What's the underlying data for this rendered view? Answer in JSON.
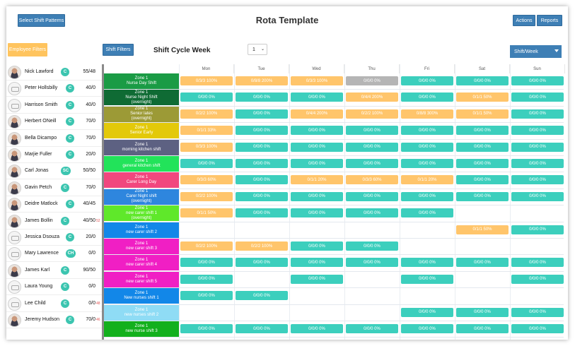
{
  "header": {
    "title": "Rota Template",
    "select_patterns_label": "Select Shift Patterns",
    "actions_label": "Actions",
    "reports_label": "Reports"
  },
  "toolbar": {
    "employee_filters_label": "Employee Filters",
    "shift_filters_label": "Shift Filters",
    "cycle_week_label": "Shift Cycle Week",
    "cycle_week_value": "1",
    "view_mode": "Shift/Week"
  },
  "days": [
    "Mon",
    "Tue",
    "Wed",
    "Thu",
    "Fri",
    "Sat",
    "Sun"
  ],
  "employees": [
    {
      "name": "Nick Lawford",
      "badge": "C",
      "ratio": "55/48",
      "extra": "",
      "avatar": "photo"
    },
    {
      "name": "Peter Hollsbilly",
      "badge": "C",
      "ratio": "40/0",
      "extra": "",
      "avatar": "logo"
    },
    {
      "name": "Harrison Smith",
      "badge": "C",
      "ratio": "40/0",
      "extra": "",
      "avatar": "logo"
    },
    {
      "name": "Herbert ONeill",
      "badge": "C",
      "ratio": "70/0",
      "extra": "",
      "avatar": "photo"
    },
    {
      "name": "Bella Dicampo",
      "badge": "C",
      "ratio": "70/0",
      "extra": "",
      "avatar": "photo"
    },
    {
      "name": "Marjie Fuller",
      "badge": "C",
      "ratio": "20/0",
      "extra": "",
      "avatar": "photo"
    },
    {
      "name": "Carl Jonas",
      "badge": "SC",
      "ratio": "50/50",
      "extra": "",
      "avatar": "photo"
    },
    {
      "name": "Gavin Petch",
      "badge": "C",
      "ratio": "70/0",
      "extra": "",
      "avatar": "photo"
    },
    {
      "name": "Deidre Matlock",
      "badge": "C",
      "ratio": "40/45",
      "extra": "",
      "avatar": "photo"
    },
    {
      "name": "James Bollin",
      "badge": "C",
      "ratio": "40/50",
      "extra": "52",
      "avatar": "photo"
    },
    {
      "name": "Jessica Dsouza",
      "badge": "C",
      "ratio": "20/0",
      "extra": "",
      "avatar": "logo"
    },
    {
      "name": "Mary Lawrence",
      "badge": "CH",
      "ratio": "0/0",
      "extra": "",
      "avatar": "logo"
    },
    {
      "name": "James Karl",
      "badge": "C",
      "ratio": "90/50",
      "extra": "",
      "avatar": "photo"
    },
    {
      "name": "Laura Young",
      "badge": "C",
      "ratio": "0/0",
      "extra": "",
      "avatar": "logo"
    },
    {
      "name": "Lee Child",
      "badge": "C",
      "ratio": "0/0",
      "extra": "48",
      "avatar": "logo"
    },
    {
      "name": "Jeremy Hudson",
      "badge": "C",
      "ratio": "70/0",
      "extra": "46",
      "avatar": "photo"
    }
  ],
  "shifts": [
    {
      "zone": "Zone 1",
      "name": "Nurse Day Shift",
      "sub": "",
      "color": "#1a9b45",
      "cells": [
        {
          "t": "0/3/3 100%",
          "c": "o"
        },
        {
          "t": "0/8/8 200%",
          "c": "o"
        },
        {
          "t": "0/3/3 100%",
          "c": "o"
        },
        {
          "t": "0/0/0 0%",
          "c": "g"
        },
        {
          "t": "0/0/0 0%",
          "c": "t"
        },
        {
          "t": "0/0/0 0%",
          "c": "t"
        },
        {
          "t": "0/0/0 0%",
          "c": "t"
        }
      ]
    },
    {
      "zone": "Zone 1",
      "name": "Nurse Night Shift",
      "sub": "(overnight)",
      "color": "#0f6b34",
      "cells": [
        {
          "t": "0/0/0 0%",
          "c": "t"
        },
        {
          "t": "0/0/0 0%",
          "c": "t"
        },
        {
          "t": "0/0/0 0%",
          "c": "t"
        },
        {
          "t": "0/4/4 200%",
          "c": "o"
        },
        {
          "t": "0/0/0 0%",
          "c": "t"
        },
        {
          "t": "0/1/1 50%",
          "c": "o"
        },
        {
          "t": "0/0/0 0%",
          "c": "t"
        }
      ]
    },
    {
      "zone": "Zone 1",
      "name": "Senior lates",
      "sub": "(overnight)",
      "color": "#9c9a36",
      "cells": [
        {
          "t": "0/2/2 100%",
          "c": "o"
        },
        {
          "t": "0/0/0 0%",
          "c": "t"
        },
        {
          "t": "0/4/4 200%",
          "c": "o"
        },
        {
          "t": "0/2/2 100%",
          "c": "o"
        },
        {
          "t": "0/8/8 300%",
          "c": "o"
        },
        {
          "t": "0/1/1 50%",
          "c": "o"
        },
        {
          "t": "0/0/0 0%",
          "c": "t"
        }
      ]
    },
    {
      "zone": "Zone 1",
      "name": "Senior Early",
      "sub": "",
      "color": "#e3c90a",
      "cells": [
        {
          "t": "0/1/1 33%",
          "c": "o"
        },
        {
          "t": "0/0/0 0%",
          "c": "t"
        },
        {
          "t": "0/0/0 0%",
          "c": "t"
        },
        {
          "t": "0/0/0 0%",
          "c": "t"
        },
        {
          "t": "0/0/0 0%",
          "c": "t"
        },
        {
          "t": "0/0/0 0%",
          "c": "t"
        },
        {
          "t": "0/0/0 0%",
          "c": "t"
        }
      ]
    },
    {
      "zone": "Zone 1",
      "name": "morning kitchen shift",
      "sub": "",
      "color": "#5d6182",
      "cells": [
        {
          "t": "0/3/3 100%",
          "c": "o"
        },
        {
          "t": "0/0/0 0%",
          "c": "t"
        },
        {
          "t": "0/0/0 0%",
          "c": "t"
        },
        {
          "t": "0/0/0 0%",
          "c": "t"
        },
        {
          "t": "0/0/0 0%",
          "c": "t"
        },
        {
          "t": "0/0/0 0%",
          "c": "t"
        },
        {
          "t": "0/0/0 0%",
          "c": "t"
        }
      ]
    },
    {
      "zone": "Zone 1",
      "name": "general kitchen shift",
      "sub": "",
      "color": "#22e35a",
      "cells": [
        {
          "t": "0/0/0 0%",
          "c": "t"
        },
        {
          "t": "0/0/0 0%",
          "c": "t"
        },
        {
          "t": "0/0/0 0%",
          "c": "t"
        },
        {
          "t": "0/0/0 0%",
          "c": "t"
        },
        {
          "t": "0/0/0 0%",
          "c": "t"
        },
        {
          "t": "0/0/0 0%",
          "c": "t"
        },
        {
          "t": "0/0/0 0%",
          "c": "t"
        }
      ]
    },
    {
      "zone": "Zone 1",
      "name": "Carer Long Day",
      "sub": "",
      "color": "#f1477e",
      "cells": [
        {
          "t": "0/3/3 60%",
          "c": "o"
        },
        {
          "t": "0/0/0 0%",
          "c": "t"
        },
        {
          "t": "0/1/1 20%",
          "c": "o"
        },
        {
          "t": "0/3/3 60%",
          "c": "o"
        },
        {
          "t": "0/1/1 20%",
          "c": "o"
        },
        {
          "t": "0/0/0 0%",
          "c": "t"
        },
        {
          "t": "0/0/0 0%",
          "c": "t"
        }
      ]
    },
    {
      "zone": "Zone 1",
      "name": "Carer Night shift",
      "sub": "(overnight)",
      "color": "#2e86de",
      "cells": [
        {
          "t": "0/2/2 100%",
          "c": "o"
        },
        {
          "t": "0/0/0 0%",
          "c": "t"
        },
        {
          "t": "0/0/0 0%",
          "c": "t"
        },
        {
          "t": "0/0/0 0%",
          "c": "t"
        },
        {
          "t": "0/0/0 0%",
          "c": "t"
        },
        {
          "t": "0/0/0 0%",
          "c": "t"
        },
        {
          "t": "0/0/0 0%",
          "c": "t"
        }
      ]
    },
    {
      "zone": "Zone 1",
      "name": "new carer shift 1",
      "sub": "(overnight)",
      "color": "#5fe82a",
      "cells": [
        {
          "t": "0/1/1 50%",
          "c": "o"
        },
        {
          "t": "0/0/0 0%",
          "c": "t"
        },
        {
          "t": "0/0/0 0%",
          "c": "t"
        },
        {
          "t": "0/0/0 0%",
          "c": "t"
        },
        {
          "t": "0/0/0 0%",
          "c": "t"
        },
        {
          "t": "",
          "c": ""
        },
        {
          "t": "",
          "c": ""
        }
      ]
    },
    {
      "zone": "Zone 1",
      "name": "new carer shift 2",
      "sub": "",
      "color": "#1287e8",
      "cells": [
        {
          "t": "",
          "c": ""
        },
        {
          "t": "",
          "c": ""
        },
        {
          "t": "",
          "c": ""
        },
        {
          "t": "",
          "c": ""
        },
        {
          "t": "",
          "c": ""
        },
        {
          "t": "0/1/1 50%",
          "c": "o"
        },
        {
          "t": "0/0/0 0%",
          "c": "t"
        }
      ]
    },
    {
      "zone": "Zone 1",
      "name": "new carer shift 3",
      "sub": "",
      "color": "#f01fc4",
      "cells": [
        {
          "t": "0/2/2 100%",
          "c": "o"
        },
        {
          "t": "0/2/2 100%",
          "c": "o"
        },
        {
          "t": "0/0/0 0%",
          "c": "t"
        },
        {
          "t": "0/0/0 0%",
          "c": "t"
        },
        {
          "t": "",
          "c": ""
        },
        {
          "t": "",
          "c": ""
        },
        {
          "t": "",
          "c": ""
        }
      ]
    },
    {
      "zone": "Zone 1",
      "name": "new carer shift 4",
      "sub": "",
      "color": "#f01fc4",
      "cells": [
        {
          "t": "0/0/0 0%",
          "c": "t"
        },
        {
          "t": "0/0/0 0%",
          "c": "t"
        },
        {
          "t": "0/0/0 0%",
          "c": "t"
        },
        {
          "t": "0/0/0 0%",
          "c": "t"
        },
        {
          "t": "0/0/0 0%",
          "c": "t"
        },
        {
          "t": "0/0/0 0%",
          "c": "t"
        },
        {
          "t": "0/0/0 0%",
          "c": "t"
        }
      ]
    },
    {
      "zone": "Zone 1",
      "name": "new carer shift 5",
      "sub": "",
      "color": "#f01fc4",
      "cells": [
        {
          "t": "0/0/0 0%",
          "c": "t"
        },
        {
          "t": "",
          "c": ""
        },
        {
          "t": "0/0/0 0%",
          "c": "t"
        },
        {
          "t": "",
          "c": ""
        },
        {
          "t": "0/0/0 0%",
          "c": "t"
        },
        {
          "t": "",
          "c": ""
        },
        {
          "t": "0/0/0 0%",
          "c": "t"
        }
      ]
    },
    {
      "zone": "Zone 1",
      "name": "New nurses shift 1",
      "sub": "",
      "color": "#1287e8",
      "cells": [
        {
          "t": "0/0/0 0%",
          "c": "t"
        },
        {
          "t": "0/0/0 0%",
          "c": "t"
        },
        {
          "t": "",
          "c": ""
        },
        {
          "t": "",
          "c": ""
        },
        {
          "t": "",
          "c": ""
        },
        {
          "t": "",
          "c": ""
        },
        {
          "t": "",
          "c": ""
        }
      ]
    },
    {
      "zone": "Zone 1",
      "name": "new nurses shift 2",
      "sub": "",
      "color": "#8fdcf5",
      "cells": [
        {
          "t": "",
          "c": ""
        },
        {
          "t": "",
          "c": ""
        },
        {
          "t": "",
          "c": ""
        },
        {
          "t": "",
          "c": ""
        },
        {
          "t": "0/0/0 0%",
          "c": "t"
        },
        {
          "t": "0/0/0 0%",
          "c": "t"
        },
        {
          "t": "0/0/0 0%",
          "c": "t"
        }
      ]
    },
    {
      "zone": "Zone 1",
      "name": "new nurse shift 3",
      "sub": "",
      "color": "#13b01d",
      "cells": [
        {
          "t": "0/0/0 0%",
          "c": "t"
        },
        {
          "t": "0/0/0 0%",
          "c": "t"
        },
        {
          "t": "0/0/0 0%",
          "c": "t"
        },
        {
          "t": "0/0/0 0%",
          "c": "t"
        },
        {
          "t": "0/0/0 0%",
          "c": "t"
        },
        {
          "t": "0/0/0 0%",
          "c": "t"
        },
        {
          "t": "0/0/0 0%",
          "c": "t"
        }
      ]
    }
  ]
}
